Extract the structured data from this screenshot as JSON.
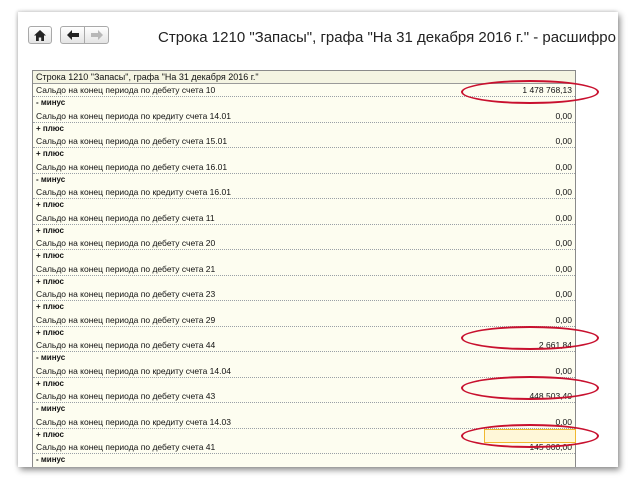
{
  "window": {
    "title": "Строка 1210 \"Запасы\", графа \"На 31 декабря 2016 г.\" - расшифро"
  },
  "toolbar": {
    "home_icon": "home-icon",
    "back_icon": "arrow-left-icon",
    "forward_icon": "arrow-right-icon"
  },
  "report": {
    "header": "Строка 1210 \"Запасы\", графа \"На 31 декабря 2016 г.\"",
    "rows": [
      {
        "label": "Сальдо на конец периода по дебету счета 10",
        "value": "1 478 768,13"
      },
      {
        "label": "- минус",
        "value": ""
      },
      {
        "label": "Сальдо на конец периода по кредиту счета 14.01",
        "value": "0,00"
      },
      {
        "label": "+ плюс",
        "value": ""
      },
      {
        "label": "Сальдо на конец периода по дебету счета 15.01",
        "value": "0,00"
      },
      {
        "label": "+ плюс",
        "value": ""
      },
      {
        "label": "Сальдо на конец периода по дебету счета 16.01",
        "value": "0,00"
      },
      {
        "label": "- минус",
        "value": ""
      },
      {
        "label": "Сальдо на конец периода по кредиту счета 16.01",
        "value": "0,00"
      },
      {
        "label": "+ плюс",
        "value": ""
      },
      {
        "label": "Сальдо на конец периода по дебету счета 11",
        "value": "0,00"
      },
      {
        "label": "+ плюс",
        "value": ""
      },
      {
        "label": "Сальдо на конец периода по дебету счета 20",
        "value": "0,00"
      },
      {
        "label": "+ плюс",
        "value": ""
      },
      {
        "label": "Сальдо на конец периода по дебету счета 21",
        "value": "0,00"
      },
      {
        "label": "+ плюс",
        "value": ""
      },
      {
        "label": "Сальдо на конец периода по дебету счета 23",
        "value": "0,00"
      },
      {
        "label": "+ плюс",
        "value": ""
      },
      {
        "label": "Сальдо на конец периода по дебету счета 29",
        "value": "0,00"
      },
      {
        "label": "+ плюс",
        "value": ""
      },
      {
        "label": "Сальдо на конец периода по дебету счета 44",
        "value": "2 661,84"
      },
      {
        "label": "- минус",
        "value": ""
      },
      {
        "label": "Сальдо на конец периода по кредиту счета 14.04",
        "value": "0,00"
      },
      {
        "label": "+ плюс",
        "value": ""
      },
      {
        "label": "Сальдо на конец периода по дебету счета 43",
        "value": "448 503,40"
      },
      {
        "label": "- минус",
        "value": ""
      },
      {
        "label": "Сальдо на конец периода по кредиту счета 14.03",
        "value": "0,00"
      },
      {
        "label": "+ плюс",
        "value": ""
      },
      {
        "label": "Сальдо на конец периода по дебету счета 41",
        "value": "145 000,00"
      },
      {
        "label": "- минус",
        "value": ""
      }
    ]
  },
  "annotations": {
    "oval_color": "#c8102e",
    "highlight_color": "#f0b830"
  }
}
